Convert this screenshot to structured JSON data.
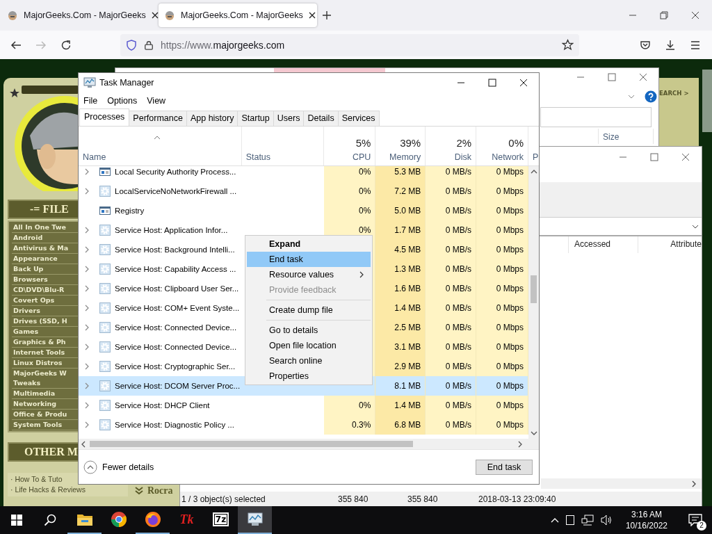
{
  "browser": {
    "tabs": [
      {
        "title": "MajorGeeks.Com - MajorGeeks",
        "selected": false
      },
      {
        "title": "MajorGeeks.Com - MajorGeeks",
        "selected": true
      }
    ],
    "nav": [
      {
        "kind": "back",
        "disabled": false
      },
      {
        "kind": "forward",
        "disabled": true
      },
      {
        "kind": "reload",
        "disabled": false
      }
    ],
    "url": {
      "prefix": "https://www.",
      "host": "majorgeeks.com"
    }
  },
  "site": {
    "files_heading": "-= FILE",
    "categories": [
      [
        "All In One Twe"
      ],
      [
        "Android"
      ],
      [
        "Antivirus & Ma"
      ],
      [
        "Appearance"
      ],
      [
        "Back Up"
      ],
      [
        "Browsers"
      ],
      [
        "CD\\DVD\\Blu-R"
      ],
      [
        "Covert Ops"
      ],
      [
        "Drivers"
      ],
      [
        "Drives (SSD, H"
      ],
      [
        "Games"
      ],
      [
        "Graphics & Ph"
      ],
      [
        "Internet Tools"
      ],
      [
        "Linux Distros"
      ],
      [
        "MajorGeeks W",
        "Tweaks"
      ],
      [
        "Multimedia"
      ],
      [
        "Networking"
      ],
      [
        "Office & Produ"
      ],
      [
        "System Tools"
      ]
    ],
    "other_heading": "OTHER M",
    "other_links": [
      "· How To & Tuto",
      "· Life Hacks & Reviews"
    ],
    "banner": "Rocra",
    "search_link": "EARCH >"
  },
  "explorer_back": {
    "columns": [
      "Size"
    ]
  },
  "explorer_front": {
    "columns": [
      "Accessed",
      "Attribute"
    ],
    "status": [
      "1 / 3 object(s) selected",
      "355 840",
      "355 840",
      "2018-03-13 23:09:40"
    ]
  },
  "task_manager": {
    "title": "Task Manager",
    "menu": [
      "File",
      "Options",
      "View"
    ],
    "tabs": [
      {
        "label": "Processes",
        "selected": true
      },
      {
        "label": "Performance",
        "selected": false
      },
      {
        "label": "App history",
        "selected": false
      },
      {
        "label": "Startup",
        "selected": false
      },
      {
        "label": "Users",
        "selected": false
      },
      {
        "label": "Details",
        "selected": false
      },
      {
        "label": "Services",
        "selected": false
      }
    ],
    "columns": [
      {
        "label": "Name",
        "kind": "text"
      },
      {
        "label": "Status",
        "kind": "text"
      },
      {
        "label": "CPU",
        "kind": "metric",
        "percent": "5%"
      },
      {
        "label": "Memory",
        "kind": "metric",
        "percent": "39%"
      },
      {
        "label": "Disk",
        "kind": "metric",
        "percent": "2%"
      },
      {
        "label": "Network",
        "kind": "metric",
        "percent": "0%"
      },
      {
        "label": "P",
        "kind": "edge"
      }
    ],
    "rows": [
      {
        "name": "Local Security Authority Process...",
        "kind": "app",
        "expandable": true,
        "selected": false,
        "cpu": "0%",
        "memory": "5.3 MB",
        "disk": "0 MB/s",
        "network": "0 Mbps"
      },
      {
        "name": "LocalServiceNoNetworkFirewall ...",
        "kind": "service",
        "expandable": true,
        "selected": false,
        "cpu": "0%",
        "memory": "7.2 MB",
        "disk": "0 MB/s",
        "network": "0 Mbps"
      },
      {
        "name": "Registry",
        "kind": "app",
        "expandable": false,
        "selected": false,
        "cpu": "0%",
        "memory": "5.0 MB",
        "disk": "0 MB/s",
        "network": "0 Mbps"
      },
      {
        "name": "Service Host: Application Infor...",
        "kind": "service",
        "expandable": true,
        "selected": false,
        "cpu": "0%",
        "memory": "1.7 MB",
        "disk": "0 MB/s",
        "network": "0 Mbps"
      },
      {
        "name": "Service Host: Background Intelli...",
        "kind": "service",
        "expandable": true,
        "selected": false,
        "memory": "4.5 MB",
        "disk": "0 MB/s",
        "network": "0 Mbps"
      },
      {
        "name": "Service Host: Capability Access ...",
        "kind": "service",
        "expandable": true,
        "selected": false,
        "memory": "1.3 MB",
        "disk": "0 MB/s",
        "network": "0 Mbps"
      },
      {
        "name": "Service Host: Clipboard User Ser...",
        "kind": "service",
        "expandable": true,
        "selected": false,
        "memory": "1.6 MB",
        "disk": "0 MB/s",
        "network": "0 Mbps"
      },
      {
        "name": "Service Host: COM+ Event Syste...",
        "kind": "service",
        "expandable": true,
        "selected": false,
        "memory": "1.4 MB",
        "disk": "0 MB/s",
        "network": "0 Mbps"
      },
      {
        "name": "Service Host: Connected Device...",
        "kind": "service",
        "expandable": true,
        "selected": false,
        "memory": "2.5 MB",
        "disk": "0 MB/s",
        "network": "0 Mbps"
      },
      {
        "name": "Service Host: Connected Device...",
        "kind": "service",
        "expandable": true,
        "selected": false,
        "memory": "3.1 MB",
        "disk": "0 MB/s",
        "network": "0 Mbps"
      },
      {
        "name": "Service Host: Cryptographic Ser...",
        "kind": "service",
        "expandable": true,
        "selected": false,
        "memory": "2.9 MB",
        "disk": "0 MB/s",
        "network": "0 Mbps"
      },
      {
        "name": "Service Host: DCOM Server Proc...",
        "kind": "service",
        "expandable": true,
        "selected": true,
        "memory": "8.1 MB",
        "disk": "0 MB/s",
        "network": "0 Mbps"
      },
      {
        "name": "Service Host: DHCP Client",
        "kind": "service",
        "expandable": true,
        "selected": false,
        "cpu": "0%",
        "memory": "1.4 MB",
        "disk": "0 MB/s",
        "network": "0 Mbps"
      },
      {
        "name": "Service Host: Diagnostic Policy ...",
        "kind": "service",
        "expandable": true,
        "selected": false,
        "cpu": "0.3%",
        "memory": "6.8 MB",
        "disk": "0 MB/s",
        "network": "0 Mbps"
      }
    ],
    "context_menu": [
      {
        "label": "Expand",
        "kind": "default",
        "selected": false
      },
      {
        "label": "End task",
        "kind": "item",
        "selected": true
      },
      {
        "label": "Resource values",
        "kind": "submenu",
        "selected": false
      },
      {
        "label": "Provide feedback",
        "kind": "disabled",
        "selected": false
      },
      {
        "kind": "separator"
      },
      {
        "label": "Create dump file",
        "kind": "item",
        "selected": false
      },
      {
        "kind": "separator"
      },
      {
        "label": "Go to details",
        "kind": "item",
        "selected": false
      },
      {
        "label": "Open file location",
        "kind": "item",
        "selected": false
      },
      {
        "label": "Search online",
        "kind": "item",
        "selected": false
      },
      {
        "label": "Properties",
        "kind": "item",
        "selected": false
      }
    ],
    "fewer_details": "Fewer details",
    "end_task": "End task"
  },
  "taskbar": {
    "apps": [
      {
        "kind": "explorer",
        "running": true,
        "active": false
      },
      {
        "kind": "chrome",
        "running": false,
        "active": false
      },
      {
        "kind": "firefox",
        "running": true,
        "active": false
      },
      {
        "kind": "tk",
        "label": "Tk",
        "running": false,
        "active": false
      },
      {
        "kind": "sevenzip",
        "label": "7z",
        "running": false,
        "active": false
      },
      {
        "kind": "taskmgr",
        "running": true,
        "active": true
      }
    ],
    "time": "3:16 AM",
    "date": "10/16/2022",
    "notifications": "2"
  }
}
